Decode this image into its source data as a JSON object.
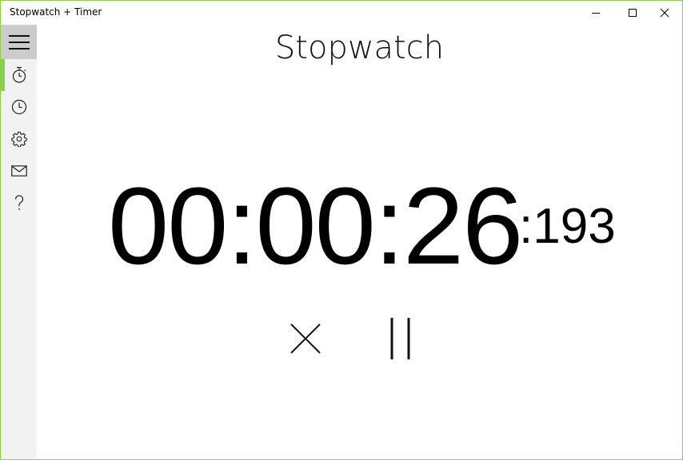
{
  "window": {
    "title": "Stopwatch + Timer",
    "accent_color": "#8ccf4b",
    "controls": {
      "minimize_icon": "minimize-icon",
      "maximize_icon": "maximize-icon",
      "close_icon": "close-icon"
    }
  },
  "sidebar": {
    "menu_icon": "hamburger-menu-icon",
    "items": [
      {
        "id": "stopwatch",
        "icon": "stopwatch-icon",
        "active": true
      },
      {
        "id": "timer",
        "icon": "clock-icon",
        "active": false
      },
      {
        "id": "settings",
        "icon": "gear-icon",
        "active": false
      },
      {
        "id": "feedback",
        "icon": "mail-icon",
        "active": false
      },
      {
        "id": "help",
        "icon": "question-mark-icon",
        "active": false
      }
    ]
  },
  "main": {
    "title": "Stopwatch",
    "time": "00:00:26",
    "milliseconds": ":193",
    "controls": {
      "reset_icon": "reset-x-icon",
      "pause_icon": "pause-icon"
    }
  }
}
